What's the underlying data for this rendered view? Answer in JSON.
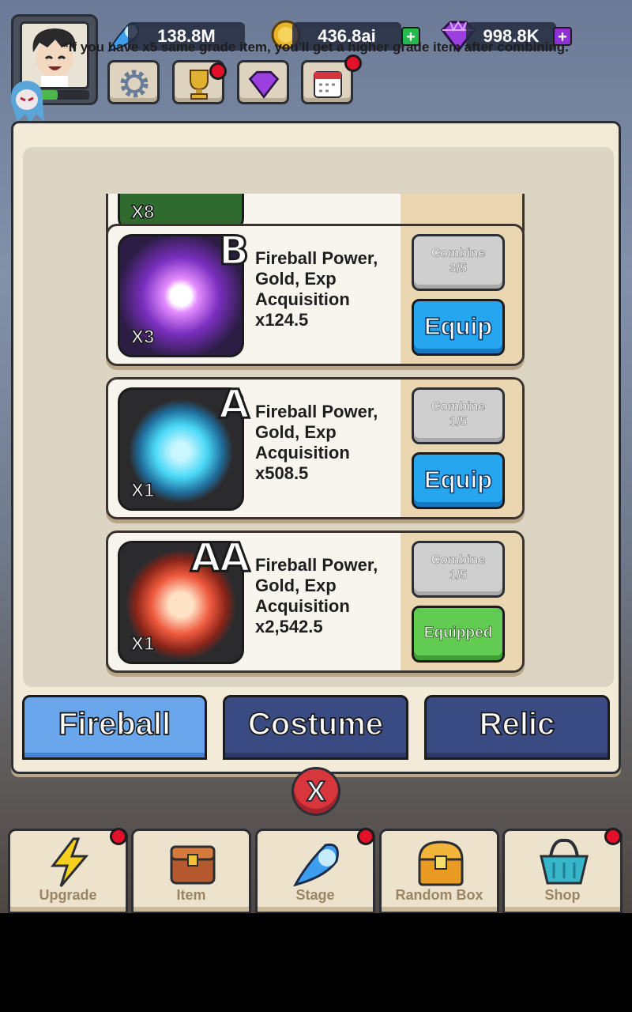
{
  "hud": {
    "fireball_count": "138.8M",
    "gold": "436.8ai",
    "gems": "998.8K",
    "avatar_exp": 0.55
  },
  "panel": {
    "note": "*If you have x5 same grade item, you'll get a higher grade item after combining.",
    "items": [
      {
        "grade": "B",
        "qty": "X3",
        "desc": "Fireball Power, Gold, Exp Acquisition x124.5",
        "combine_label": "Combine",
        "combine_count": "3/5",
        "equip_label": "Equip",
        "state": "equip",
        "color": "#c14cf0"
      },
      {
        "grade": "A",
        "qty": "X1",
        "desc": "Fireball Power, Gold, Exp Acquisition x508.5",
        "combine_label": "Combine",
        "combine_count": "1/5",
        "equip_label": "Equip",
        "state": "equip",
        "color": "#4ad8f6"
      },
      {
        "grade": "AA",
        "qty": "X1",
        "desc": "Fireball Power, Gold, Exp Acquisition x2,542.5",
        "combine_label": "Combine",
        "combine_count": "1/5",
        "equip_label": "Equipped",
        "state": "equipped",
        "color": "#ef5a3e"
      }
    ],
    "partial_qty": "X8",
    "tabs": [
      "Fireball",
      "Costume",
      "Relic"
    ],
    "close_label": "X"
  },
  "nav": [
    "Upgrade",
    "Item",
    "Stage",
    "Random Box",
    "Shop"
  ],
  "colors": {
    "accent_blue": "#25a6ef",
    "equipped_green": "#62cc52",
    "badge_red": "#e3102a"
  }
}
